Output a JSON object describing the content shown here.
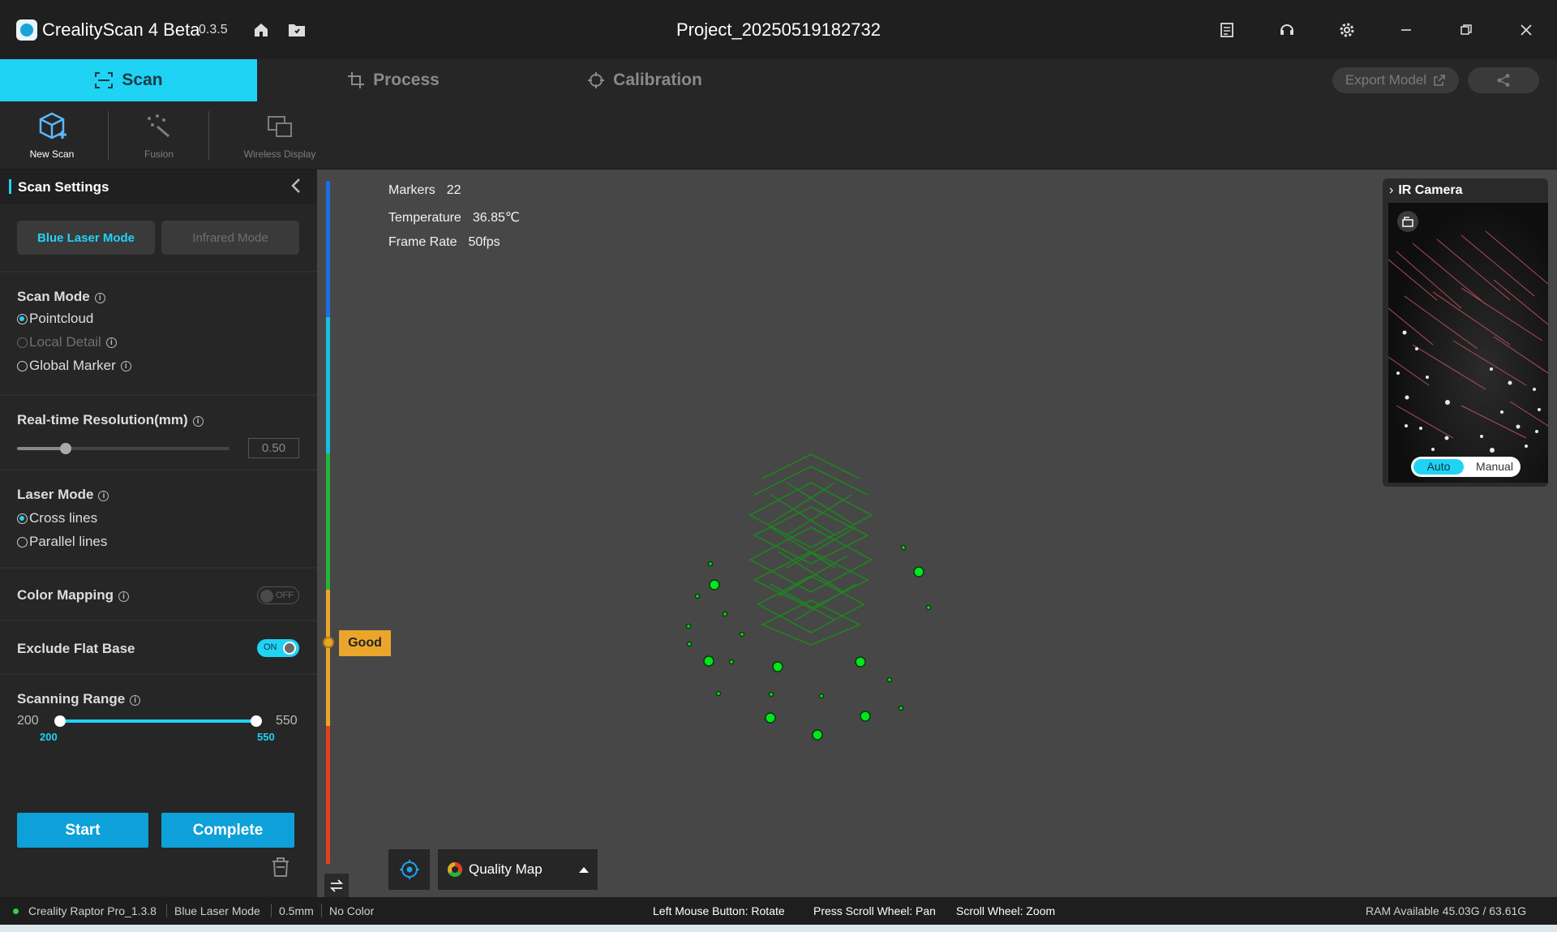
{
  "app": {
    "name": "CrealityScan 4 Beta",
    "version": "0.3.5",
    "project_title": "Project_20250519182732"
  },
  "tabs": [
    {
      "label": "Scan"
    },
    {
      "label": "Process"
    },
    {
      "label": "Calibration"
    }
  ],
  "header_actions": {
    "export_label": "Export Model"
  },
  "toolbar": {
    "new_scan": "New Scan",
    "fusion": "Fusion",
    "wireless": "Wireless Display"
  },
  "sidebar": {
    "title": "Scan Settings",
    "modes": {
      "blue": "Blue Laser Mode",
      "infrared": "Infrared Mode"
    },
    "scan_mode": {
      "label": "Scan Mode",
      "options": [
        "Pointcloud",
        "Local Detail",
        "Global Marker"
      ],
      "selected": "Pointcloud"
    },
    "resolution": {
      "label": "Real-time Resolution(mm)",
      "value": "0.50",
      "level": 0.2
    },
    "laser_mode": {
      "label": "Laser Mode",
      "options": [
        "Cross lines",
        "Parallel lines"
      ],
      "selected": "Cross lines"
    },
    "color_mapping": {
      "label": "Color Mapping",
      "state": "OFF"
    },
    "exclude_flat_base": {
      "label": "Exclude Flat Base",
      "state": "ON"
    },
    "scanning_range": {
      "label": "Scanning Range",
      "min": "200",
      "max": "550",
      "low": "200",
      "high": "550"
    },
    "start_label": "Start",
    "complete_label": "Complete"
  },
  "viewport": {
    "stats": [
      {
        "label": "Markers",
        "value": "22"
      },
      {
        "label": "Temperature",
        "value": "36.85℃"
      },
      {
        "label": "Frame Rate",
        "value": "50fps"
      }
    ],
    "quality_tag": "Good",
    "quality_map_label": "Quality Map",
    "ir_camera": {
      "title": "IR Camera",
      "auto": "Auto",
      "manual": "Manual"
    }
  },
  "statusbar": {
    "device": "Creality Raptor Pro_1.3.8",
    "mode": "Blue Laser Mode",
    "resolution": "0.5mm",
    "color": "No Color",
    "hint_rotate": "Left Mouse Button: Rotate",
    "hint_pan": "Press Scroll Wheel: Pan",
    "hint_zoom": "Scroll Wheel: Zoom",
    "ram": "RAM Available 45.03G / 63.61G"
  },
  "colors": {
    "accent": "#1fd3f5",
    "primary": "#0ea0d8",
    "good": "#e9a62b",
    "marker": "#00e61e"
  }
}
